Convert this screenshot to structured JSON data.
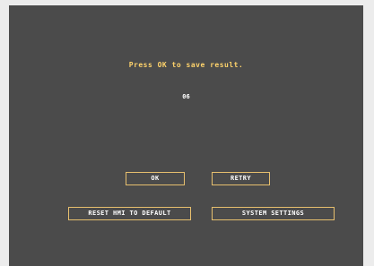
{
  "screen": {
    "message": "Press OK to save result.",
    "result_value": "06"
  },
  "buttons": {
    "ok": "OK",
    "retry": "RETRY",
    "reset_hmi": "RESET HMI TO DEFAULT",
    "system_settings": "SYSTEM SETTINGS"
  },
  "colors": {
    "background": "#ececec",
    "panel": "#4b4b4b",
    "prompt_text": "#ffd36b",
    "button_border": "#e6bf6e",
    "button_text": "#ffffff"
  }
}
